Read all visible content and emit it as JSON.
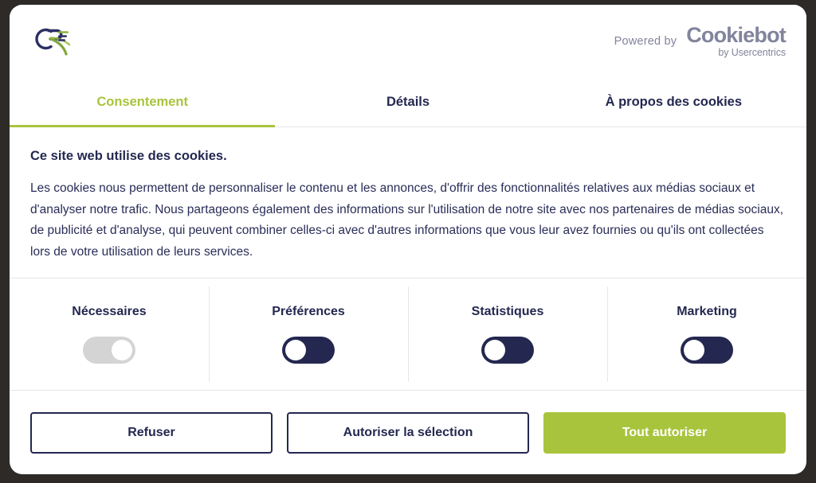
{
  "header": {
    "logo_name": "cre-logo",
    "powered_by_label": "Powered by",
    "cookiebot_name": "Cookiebot",
    "cookiebot_sub": "by Usercentrics"
  },
  "tabs": [
    {
      "label": "Consentement",
      "active": true
    },
    {
      "label": "Détails",
      "active": false
    },
    {
      "label": "À propos des cookies",
      "active": false
    }
  ],
  "content": {
    "title": "Ce site web utilise des cookies.",
    "text": "Les cookies nous permettent de personnaliser le contenu et les annonces, d'offrir des fonctionnalités relatives aux médias sociaux et d'analyser notre trafic. Nous partageons également des informations sur l'utilisation de notre site avec nos partenaires de médias sociaux, de publicité et d'analyse, qui peuvent combiner celles-ci avec d'autres informations que vous leur avez fournies ou qu'ils ont collectées lors de votre utilisation de leurs services."
  },
  "categories": [
    {
      "label": "Nécessaires",
      "state": "on",
      "locked": true
    },
    {
      "label": "Préférences",
      "state": "off",
      "locked": false
    },
    {
      "label": "Statistiques",
      "state": "off",
      "locked": false
    },
    {
      "label": "Marketing",
      "state": "off",
      "locked": false
    }
  ],
  "buttons": {
    "deny": "Refuser",
    "allow_selection": "Autoriser la sélection",
    "allow_all": "Tout autoriser"
  },
  "colors": {
    "accent_green": "#a8c43d",
    "navy": "#242850",
    "muted_purple": "#82839c",
    "divider": "#e6e6ea",
    "toggle_locked": "#d4d4d4",
    "backdrop": "#2e2a28"
  }
}
